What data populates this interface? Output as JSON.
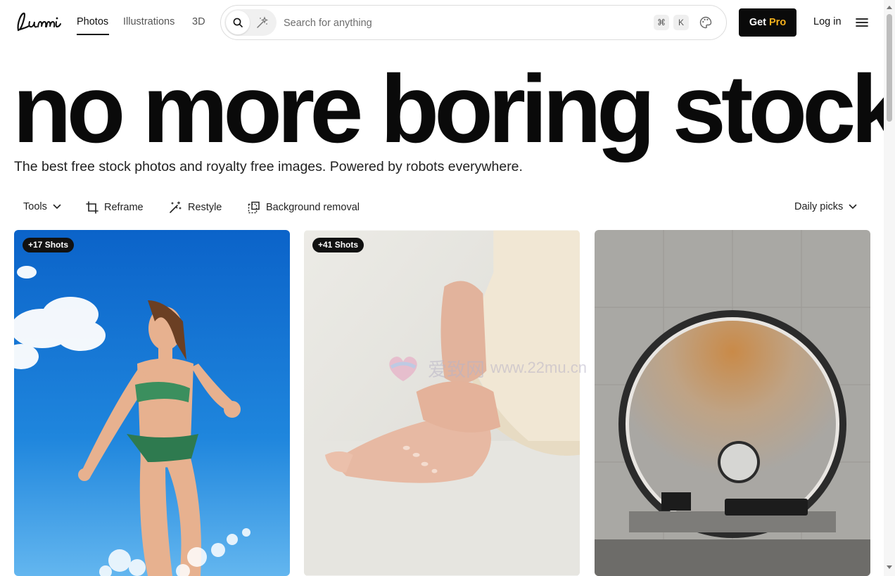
{
  "header": {
    "logo": "Lummi",
    "tabs": [
      {
        "label": "Photos",
        "active": true
      },
      {
        "label": "Illustrations",
        "active": false
      },
      {
        "label": "3D",
        "active": false
      }
    ],
    "search": {
      "placeholder": "Search for anything",
      "shortcut_cmd": "⌘",
      "shortcut_key": "K",
      "icons": [
        "search-icon",
        "sparkle-icon",
        "palette-icon"
      ]
    },
    "get_pro": {
      "prefix": "Get",
      "suffix": "Pro"
    },
    "login": "Log in",
    "menu_icon": "hamburger-icon"
  },
  "hero": {
    "title": "no more boring stock",
    "subtitle": "The best free stock photos and royalty free images. Powered by robots everywhere."
  },
  "toolbar": {
    "tools": "Tools",
    "reframe": "Reframe",
    "restyle": "Restyle",
    "background_removal": "Background removal",
    "sort": "Daily picks"
  },
  "gallery": {
    "cards": [
      {
        "badge": "+17 Shots",
        "subject": "woman-in-bikini-splashing"
      },
      {
        "badge": "+41 Shots",
        "subject": "hands-on-feet"
      },
      {
        "badge": "",
        "subject": "circular-concrete-window"
      }
    ]
  },
  "watermark": {
    "text": "爱致网",
    "url": "www.22mu.cn"
  },
  "colors": {
    "accent_pro": "#f6b11c",
    "button_dark": "#0a0a0a",
    "sky_blue": "#1f86dd"
  }
}
